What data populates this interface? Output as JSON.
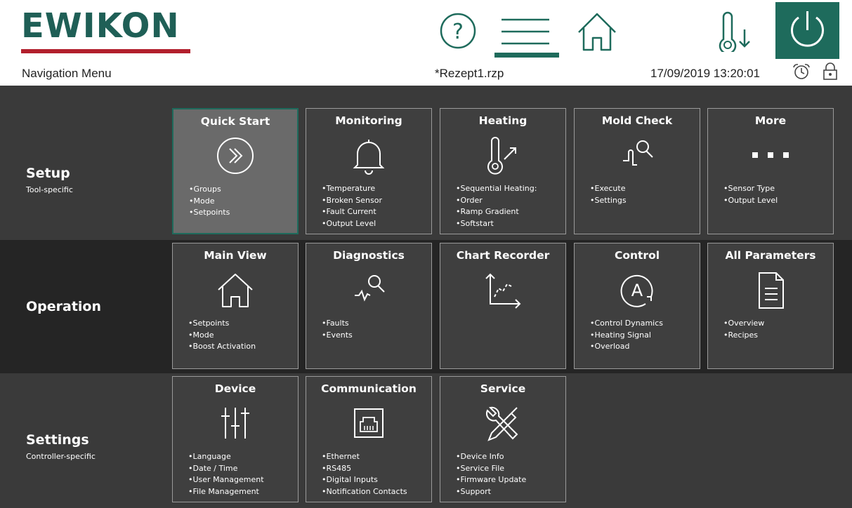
{
  "header": {
    "brand": "EWIKON",
    "page_title": "Navigation Menu",
    "file_name": "*Rezept1.rzp",
    "datetime": "17/09/2019 13:20:01",
    "icons": [
      "help-icon",
      "menu-icon",
      "home-icon",
      "temperature-down-icon",
      "power-icon",
      "alarm-clock-icon",
      "lock-icon"
    ]
  },
  "rows": [
    {
      "title": "Setup",
      "subtitle": "Tool-specific",
      "tiles": [
        {
          "title": "Quick Start",
          "icon": "fast-forward-circle-icon",
          "items": [
            "Groups",
            "Mode",
            "Setpoints"
          ]
        },
        {
          "title": "Monitoring",
          "icon": "bell-icon",
          "items": [
            "Temperature",
            "Broken Sensor",
            "Fault Current",
            "Output Level"
          ]
        },
        {
          "title": "Heating",
          "icon": "thermometer-rise-icon",
          "items": [
            "Sequential Heating:",
            "Order",
            "Ramp Gradient",
            "Softstart"
          ]
        },
        {
          "title": "Mold Check",
          "icon": "mold-check-icon",
          "items": [
            "Execute",
            "Settings"
          ]
        },
        {
          "title": "More",
          "icon": "more-dots-icon",
          "items": [
            "Sensor Type",
            "Output Level"
          ]
        }
      ]
    },
    {
      "title": "Operation",
      "subtitle": "",
      "tiles": [
        {
          "title": "Main View",
          "icon": "home-icon",
          "items": [
            "Setpoints",
            "Mode",
            "Boost Activation"
          ]
        },
        {
          "title": "Diagnostics",
          "icon": "diagnostics-icon",
          "items": [
            "Faults",
            "Events"
          ]
        },
        {
          "title": "Chart Recorder",
          "icon": "chart-icon",
          "items": []
        },
        {
          "title": "Control",
          "icon": "auto-control-icon",
          "items": [
            "Control Dynamics",
            "Heating Signal",
            "Overload"
          ]
        },
        {
          "title": "All Parameters",
          "icon": "document-icon",
          "items": [
            "Overview",
            "Recipes"
          ]
        }
      ]
    },
    {
      "title": "Settings",
      "subtitle": "Controller-specific",
      "tiles": [
        {
          "title": "Device",
          "icon": "sliders-icon",
          "items": [
            "Language",
            "Date / Time",
            "User Management",
            "File Management"
          ]
        },
        {
          "title": "Communication",
          "icon": "network-port-icon",
          "items": [
            "Ethernet",
            "RS485",
            "Digital Inputs",
            "Notification Contacts"
          ]
        },
        {
          "title": "Service",
          "icon": "tools-icon",
          "items": [
            "Device Info",
            "Service File",
            "Firmware Update",
            "Support"
          ]
        }
      ]
    }
  ],
  "colors": {
    "brand_green": "#1e6b5c",
    "brand_red": "#b21f2d",
    "row_setup": "#3a3a3a",
    "row_operation": "#252525",
    "row_settings": "#3a3a3a",
    "tile_bg": "#3f3f3f",
    "tile_active": "#6a6a6a"
  }
}
